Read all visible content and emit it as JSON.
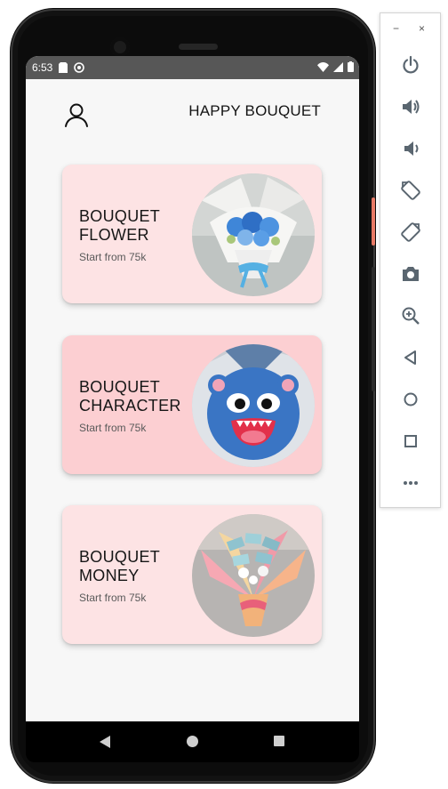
{
  "status_bar": {
    "time": "6:53"
  },
  "app": {
    "title": "HAPPY BOUQUET"
  },
  "cards": [
    {
      "title": "BOUQUET FLOWER",
      "subtitle": "Start from 75k"
    },
    {
      "title": "BOUQUET CHARACTER",
      "subtitle": "Start from 75k"
    },
    {
      "title": "BOUQUET MONEY",
      "subtitle": "Start from 75k"
    }
  ],
  "emulator": {
    "window_buttons": [
      "−",
      "×"
    ],
    "controls": [
      "power-icon",
      "volume-up-icon",
      "volume-down-icon",
      "rotate-left-icon",
      "rotate-right-icon",
      "camera-icon",
      "zoom-icon",
      "back-icon",
      "home-icon",
      "overview-icon",
      "more-icon"
    ]
  },
  "colors": {
    "card1_bg": "#fde3e4",
    "card2_bg": "#fccfd2",
    "card3_bg": "#fde3e4",
    "status_bar": "#575757"
  }
}
